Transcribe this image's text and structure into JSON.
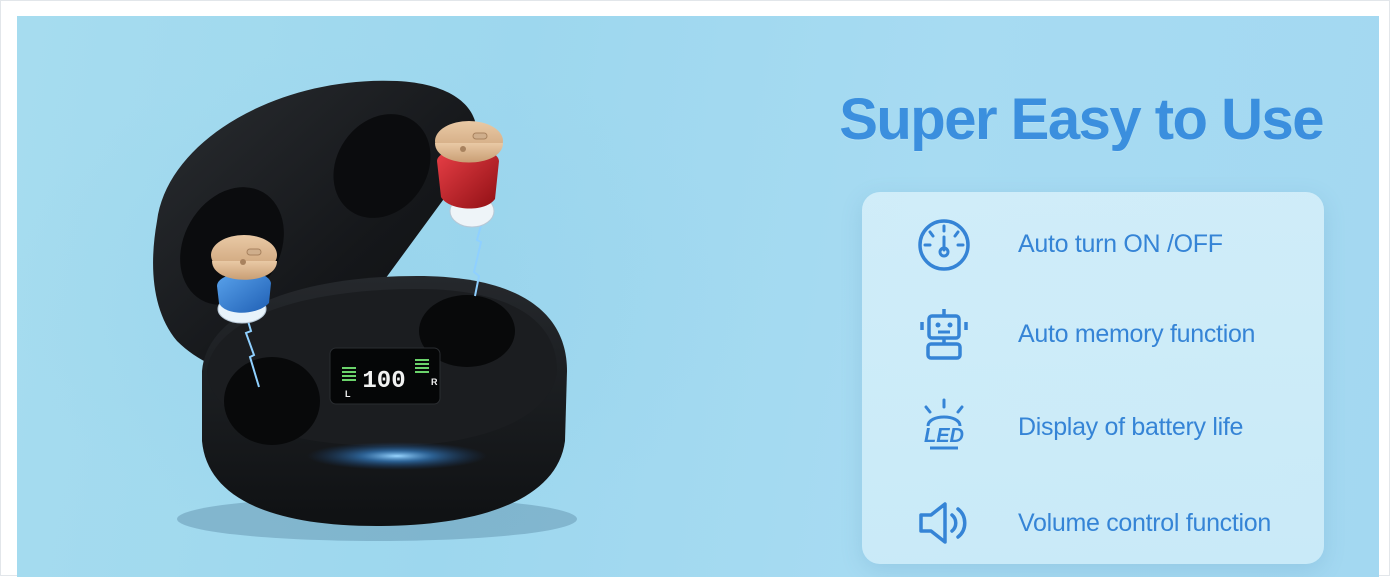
{
  "headline": "Super Easy to Use",
  "colors": {
    "accent": "#3b8fde",
    "background": "#a6dcef",
    "panel": "#d3eef9",
    "case": "#17191c",
    "led_green": "#6bd36b"
  },
  "features": [
    {
      "icon": "gauge-icon",
      "label": "Auto turn ON /OFF"
    },
    {
      "icon": "robot-icon",
      "label": "Auto memory function"
    },
    {
      "icon": "led-light-icon",
      "label": "Display of battery life",
      "icon_text": "LED"
    },
    {
      "icon": "speaker-volume-icon",
      "label": "Volume control function"
    }
  ],
  "case_display": {
    "value": "100",
    "left_label": "L",
    "right_label": "R"
  },
  "hearing_aids": [
    {
      "side": "left",
      "color": "#2f7fd6"
    },
    {
      "side": "right",
      "color": "#c81e24"
    }
  ]
}
